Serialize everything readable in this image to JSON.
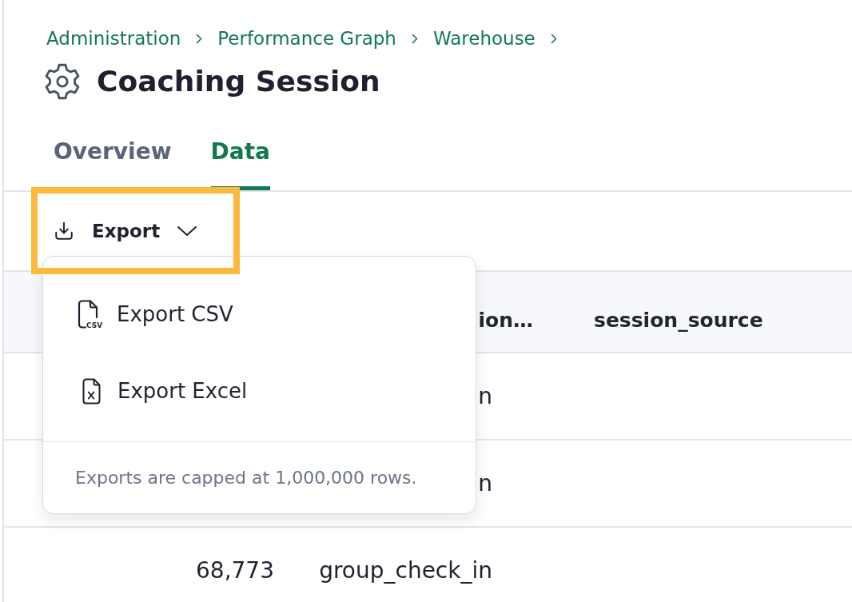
{
  "breadcrumb": [
    "Administration",
    "Performance Graph",
    "Warehouse"
  ],
  "page_title": "Coaching Session",
  "tabs": [
    {
      "label": "Overview",
      "selected": false
    },
    {
      "label": "Data",
      "selected": true
    }
  ],
  "export_button": {
    "label": "Export",
    "expanded": true,
    "highlighted": true
  },
  "export_menu": {
    "items": [
      {
        "kind": "csv",
        "label": "Export CSV",
        "icon_label": "CSV"
      },
      {
        "kind": "excel",
        "label": "Export Excel"
      }
    ],
    "note": "Exports are capped at 1,000,000 rows."
  },
  "table": {
    "header": {
      "column_2": "ion…",
      "column_3": "session_source"
    },
    "rows": [
      {
        "column_2": "n"
      },
      {
        "column_2": "n"
      },
      {
        "column_1": "68,773",
        "column_2": "group_check_in"
      }
    ]
  }
}
